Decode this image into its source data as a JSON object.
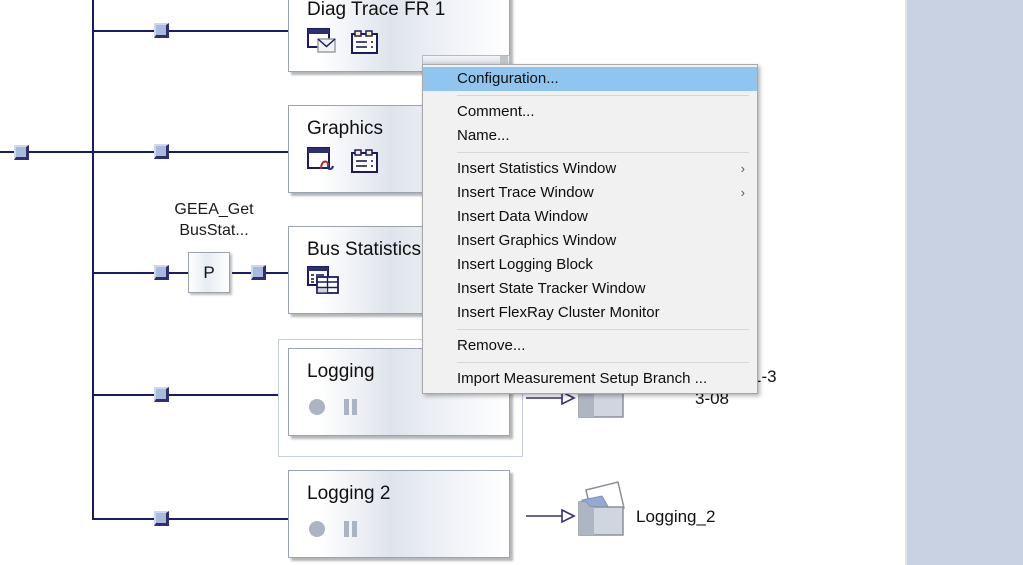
{
  "app": {
    "canvas_background": "#ffffff",
    "wire_color": "#1b1b63",
    "accent_highlight": "#8fc5ee",
    "right_panel_color": "#c9d2e2"
  },
  "blocks": [
    {
      "title": "Diag Trace FR 1",
      "icons": [
        "window-envelope-icon",
        "clipboard-list-icon"
      ]
    },
    {
      "title": "Graphics",
      "icons": [
        "window-graph-icon",
        "clipboard-list-icon"
      ]
    },
    {
      "title": "Bus Statistics",
      "icons": [
        "statistics-table-icon"
      ]
    },
    {
      "title": "Logging",
      "icons": [
        "record-dot-icon",
        "pause-icon"
      ]
    },
    {
      "title": "Logging 2",
      "icons": [
        "record-dot-icon",
        "pause-icon"
      ]
    }
  ],
  "network": {
    "function_block_label": "P",
    "function_block_name_line1": "GEEA_Get",
    "function_block_name_line2": "BusStat..."
  },
  "outputs": [
    {
      "icon": "folder-file-icon",
      "label_line1": "2020-06-09_11-3",
      "label_line2": "3-08"
    },
    {
      "icon": "folder-file-icon",
      "label_line1": "Logging_2",
      "label_line2": ""
    }
  ],
  "context_menu": {
    "items": [
      {
        "label": "Configuration...",
        "highlight": true,
        "submenu": false,
        "separator_after": true
      },
      {
        "label": "Comment...",
        "highlight": false,
        "submenu": false,
        "separator_after": false
      },
      {
        "label": "Name...",
        "highlight": false,
        "submenu": false,
        "separator_after": true
      },
      {
        "label": "Insert Statistics Window",
        "highlight": false,
        "submenu": true,
        "separator_after": false
      },
      {
        "label": "Insert Trace Window",
        "highlight": false,
        "submenu": true,
        "separator_after": false
      },
      {
        "label": "Insert Data Window",
        "highlight": false,
        "submenu": false,
        "separator_after": false
      },
      {
        "label": "Insert Graphics Window",
        "highlight": false,
        "submenu": false,
        "separator_after": false
      },
      {
        "label": "Insert Logging Block",
        "highlight": false,
        "submenu": false,
        "separator_after": false
      },
      {
        "label": "Insert State Tracker Window",
        "highlight": false,
        "submenu": false,
        "separator_after": false
      },
      {
        "label": "Insert FlexRay Cluster Monitor",
        "highlight": false,
        "submenu": false,
        "separator_after": true
      },
      {
        "label": "Remove...",
        "highlight": false,
        "submenu": false,
        "separator_after": true
      },
      {
        "label": "Import Measurement Setup Branch ...",
        "highlight": false,
        "submenu": false,
        "separator_after": false
      }
    ],
    "submenu_glyph": "›"
  }
}
